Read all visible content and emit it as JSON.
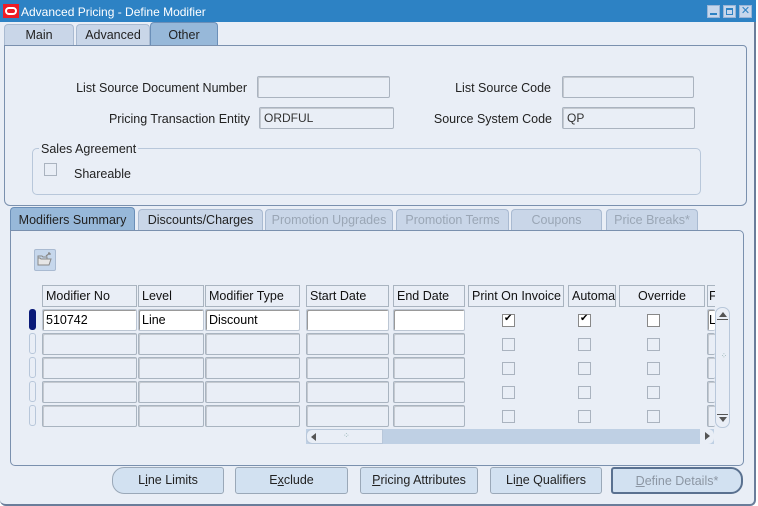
{
  "window": {
    "title": "Advanced Pricing - Define Modifier",
    "controls": [
      "minimize",
      "maximize",
      "close"
    ]
  },
  "top_tabs": [
    {
      "label": "Main",
      "active": false
    },
    {
      "label": "Advanced",
      "active": false
    },
    {
      "label": "Other",
      "active": true
    }
  ],
  "other_tab": {
    "list_source_document_number": {
      "label": "List Source Document Number",
      "value": ""
    },
    "list_source_code": {
      "label": "List Source Code",
      "value": ""
    },
    "pricing_transaction_entity": {
      "label": "Pricing Transaction Entity",
      "value": "ORDFUL"
    },
    "source_system_code": {
      "label": "Source System Code",
      "value": "QP"
    },
    "sales_agreement": {
      "title": "Sales Agreement",
      "shareable": {
        "label": "Shareable",
        "checked": false
      }
    }
  },
  "lower_tabs": [
    {
      "label": "Modifiers Summary",
      "active": true,
      "enabled": true
    },
    {
      "label": "Discounts/Charges",
      "active": false,
      "enabled": true
    },
    {
      "label": "Promotion Upgrades",
      "active": false,
      "enabled": false
    },
    {
      "label": "Promotion Terms",
      "active": false,
      "enabled": false
    },
    {
      "label": "Coupons",
      "active": false,
      "enabled": false
    },
    {
      "label": "Price Breaks*",
      "active": false,
      "enabled": false
    }
  ],
  "toolbar": {
    "open_icon": "folder-open-icon"
  },
  "grid": {
    "columns": [
      "Modifier No",
      "Level",
      "Modifier Type",
      "Start Date",
      "End Date",
      "Print On Invoice",
      "Automa",
      "Override",
      "F"
    ],
    "rows": [
      {
        "modifier_no": "510742",
        "level": "Line",
        "modifier_type": "Discount",
        "start_date": "",
        "end_date": "",
        "print_on_invoice": true,
        "automatic": true,
        "override": false,
        "extra": "L",
        "current": true
      },
      {
        "modifier_no": "",
        "level": "",
        "modifier_type": "",
        "start_date": "",
        "end_date": "",
        "print_on_invoice": false,
        "automatic": false,
        "override": false,
        "extra": "",
        "current": false
      },
      {
        "modifier_no": "",
        "level": "",
        "modifier_type": "",
        "start_date": "",
        "end_date": "",
        "print_on_invoice": false,
        "automatic": false,
        "override": false,
        "extra": "",
        "current": false
      },
      {
        "modifier_no": "",
        "level": "",
        "modifier_type": "",
        "start_date": "",
        "end_date": "",
        "print_on_invoice": false,
        "automatic": false,
        "override": false,
        "extra": "",
        "current": false
      },
      {
        "modifier_no": "",
        "level": "",
        "modifier_type": "",
        "start_date": "",
        "end_date": "",
        "print_on_invoice": false,
        "automatic": false,
        "override": false,
        "extra": "",
        "current": false
      }
    ]
  },
  "buttons": {
    "line_limits": {
      "label_pre": "L",
      "mnemonic": "i",
      "label_post": "ne Limits"
    },
    "exclude": {
      "label_pre": "E",
      "mnemonic": "x",
      "label_post": "clude"
    },
    "pricing_attributes": {
      "label_pre": "",
      "mnemonic": "P",
      "label_post": "ricing Attributes"
    },
    "line_qualifiers": {
      "label_pre": "Li",
      "mnemonic": "n",
      "label_post": "e Qualifiers"
    },
    "define_details": {
      "label_pre": "",
      "mnemonic": "D",
      "label_post": "efine Details*",
      "enabled": false
    }
  }
}
